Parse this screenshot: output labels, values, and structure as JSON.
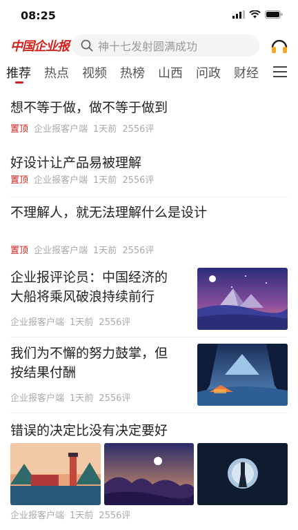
{
  "status": {
    "time": "08:25"
  },
  "header": {
    "logo": "中国企业报",
    "search_placeholder": "神十七发射圆满成功"
  },
  "tabs": [
    {
      "label": "推荐"
    },
    {
      "label": "热点"
    },
    {
      "label": "视频"
    },
    {
      "label": "热榜"
    },
    {
      "label": "山西"
    },
    {
      "label": "问政"
    },
    {
      "label": "财经"
    }
  ],
  "feed": [
    {
      "title": "想不等于做，做不等于做到",
      "pin": "置顶",
      "source": "企业报客户端",
      "time": "1天前",
      "comments": "2556评"
    },
    {
      "title": "好设计让产品易被理解",
      "pin": "置顶",
      "source": "企业报客户端",
      "time": "1天前",
      "comments": "2556评"
    },
    {
      "title": "不理解人，就无法理解什么是设计",
      "pin": "置顶",
      "source": "企业报客户端",
      "time": "1天前",
      "comments": "2556评"
    },
    {
      "title_line1": "企业报评论员：中国经济的",
      "title_line2": "大船将乘风破浪持续前行",
      "source": "企业报客户端",
      "time": "1天前",
      "comments": "2556评"
    },
    {
      "title_line1": "我们为不懈的努力鼓掌，但",
      "title_line2": "按结果付酬",
      "source": "企业报客户端",
      "time": "1天前",
      "comments": "2556评"
    },
    {
      "title": "错误的决定比没有决定要好",
      "source": "企业报客户端",
      "time": "1天前",
      "comments": "2556评"
    }
  ]
}
